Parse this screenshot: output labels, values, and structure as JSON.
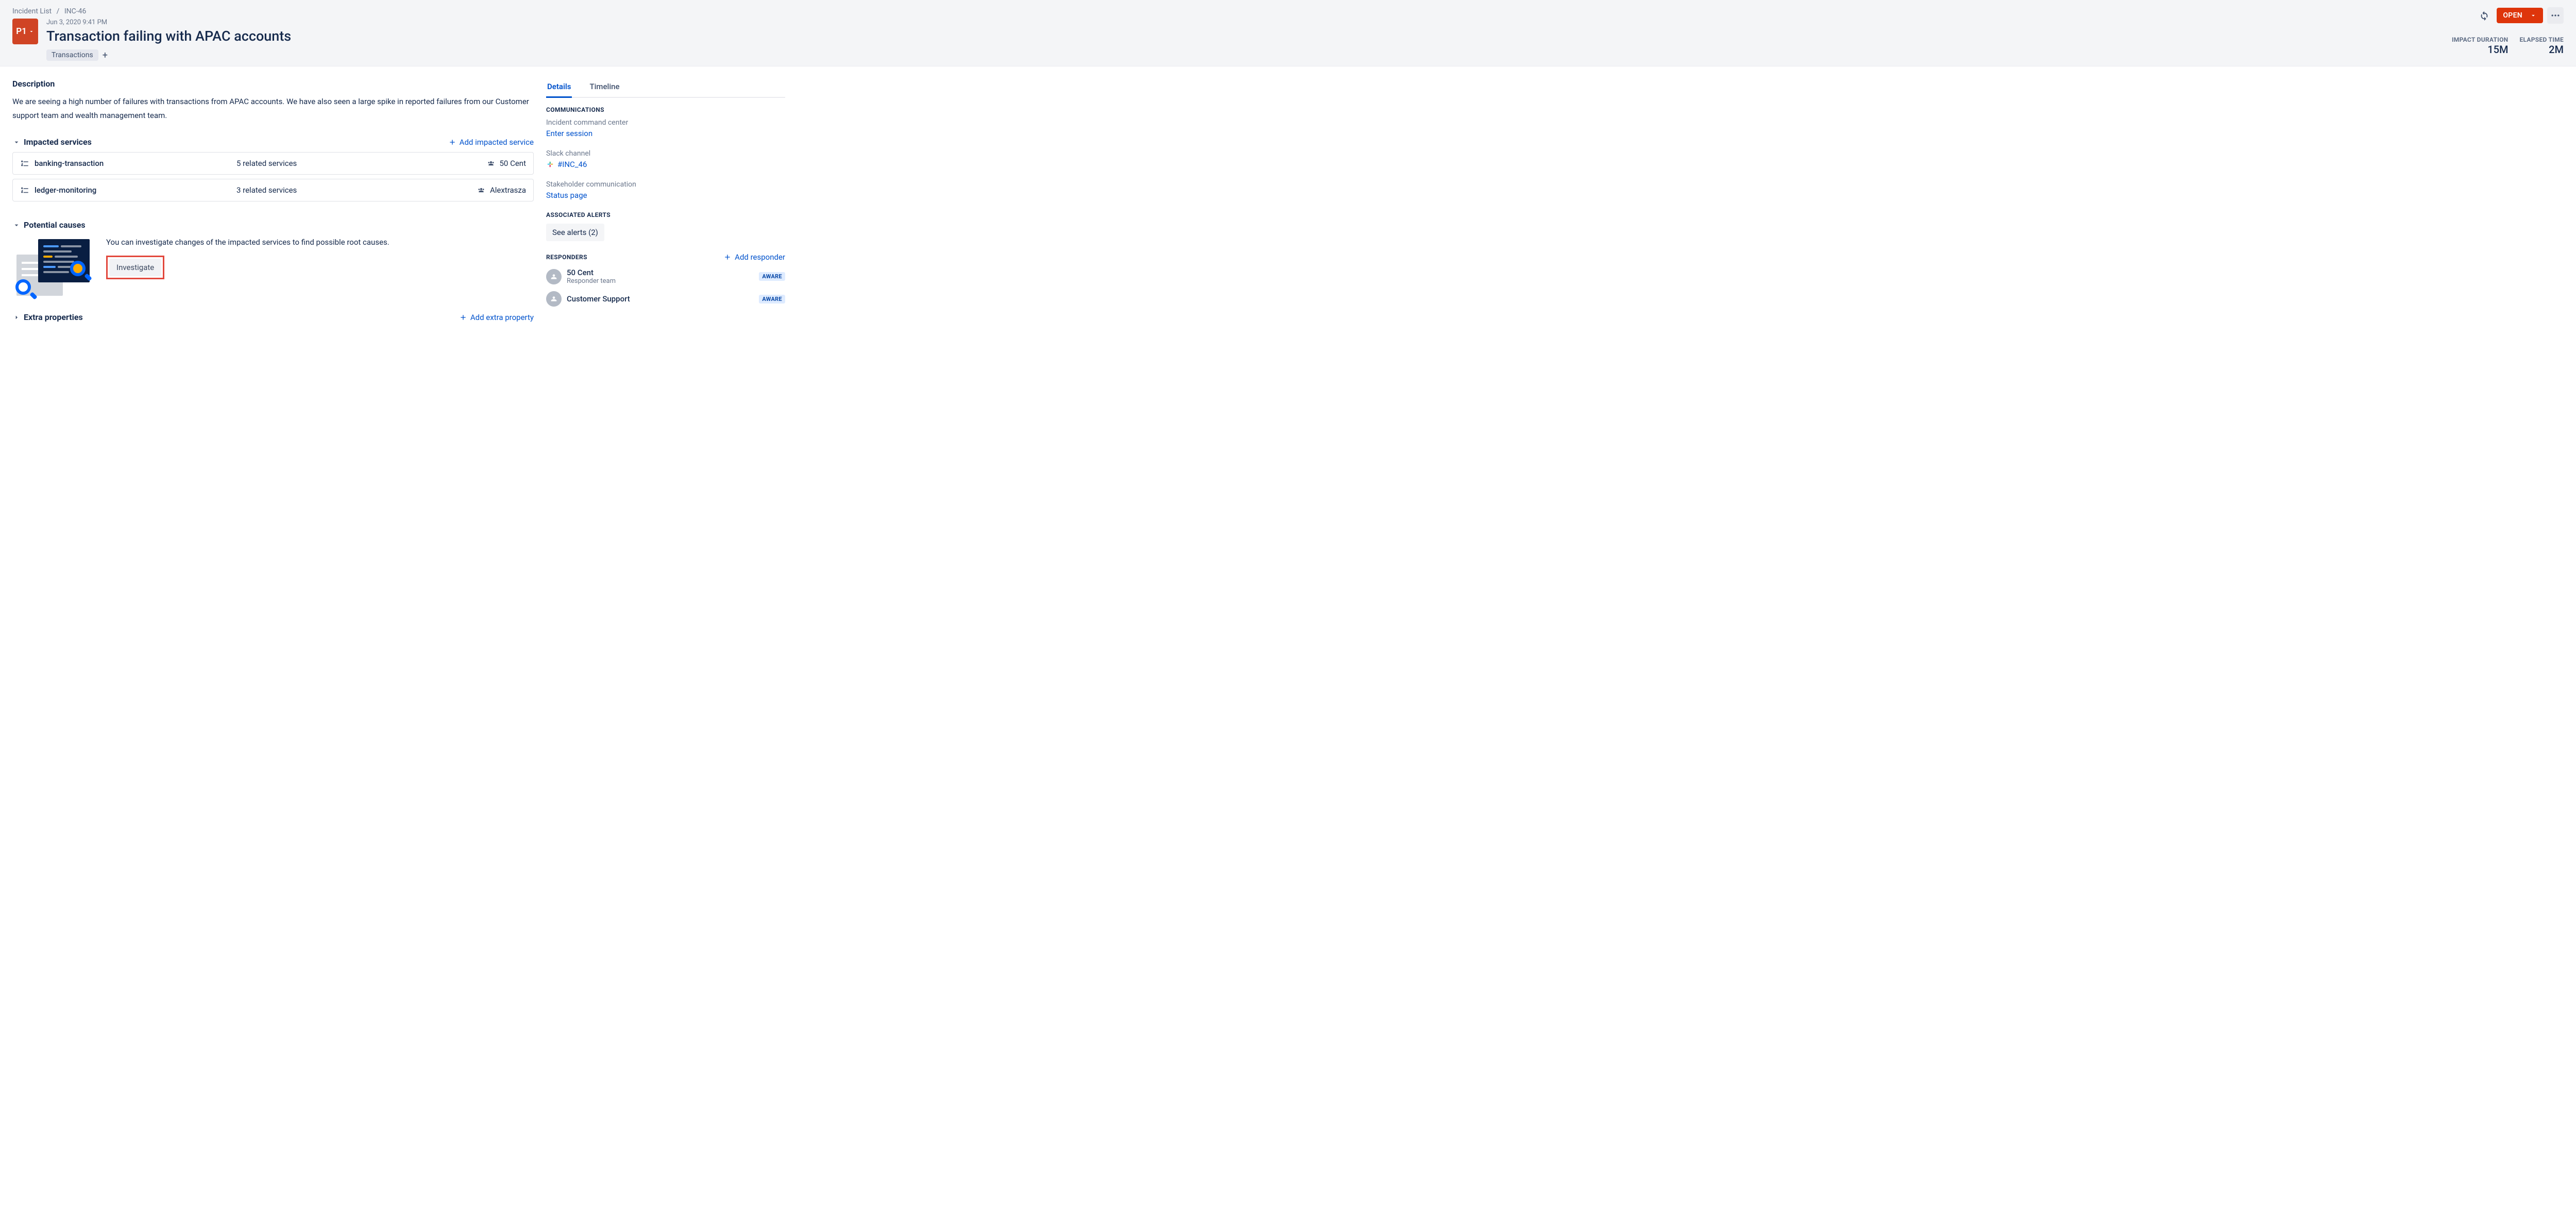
{
  "breadcrumb": {
    "root": "Incident List",
    "id": "INC-46"
  },
  "priority": "P1",
  "timestamp": "Jun 3, 2020 9:41 PM",
  "title": "Transaction failing with APAC accounts",
  "tags": [
    "Transactions"
  ],
  "status_button": "OPEN",
  "stats": {
    "impact_duration_label": "IMPACT DURATION",
    "impact_duration_value": "15M",
    "elapsed_label": "ELAPSED TIME",
    "elapsed_value": "2M"
  },
  "sections": {
    "description_label": "Description",
    "description_text": "We are seeing a high number of failures with transactions from APAC accounts. We have also seen a large spike in reported failures from our Customer support team and wealth management team.",
    "impacted_label": "Impacted services",
    "add_impacted": "Add impacted service",
    "impacted": [
      {
        "name": "banking-transaction",
        "related": "5 related services",
        "team": "50 Cent"
      },
      {
        "name": "ledger-monitoring",
        "related": "3 related services",
        "team": "Alextrasza"
      }
    ],
    "potential_label": "Potential causes",
    "potential_text": "You can investigate changes of the impacted services to find possible root causes.",
    "investigate_btn": "Investigate",
    "extra_label": "Extra properties",
    "add_extra": "Add extra property"
  },
  "side": {
    "tabs": {
      "details": "Details",
      "timeline": "Timeline"
    },
    "communications_label": "COMMUNICATIONS",
    "icc_label": "Incident command center",
    "icc_link": "Enter session",
    "slack_label": "Slack channel",
    "slack_link": "#INC_46",
    "stakeholder_label": "Stakeholder communication",
    "stakeholder_link": "Status page",
    "alerts_label": "ASSOCIATED ALERTS",
    "alerts_btn": "See alerts (2)",
    "responders_label": "RESPONDERS",
    "add_responder": "Add responder",
    "responders": [
      {
        "name": "50 Cent",
        "sub": "Responder team",
        "badge": "AWARE"
      },
      {
        "name": "Customer Support",
        "sub": "",
        "badge": "AWARE"
      }
    ]
  }
}
